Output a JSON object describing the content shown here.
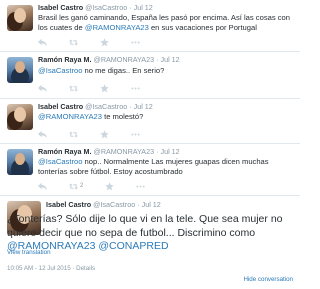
{
  "tweets": [
    {
      "name": "Isabel Castro",
      "handle": "@IsaCastroo",
      "time": "Jul 12",
      "text_before": "Brasil les ganó caminando, España les pasó por encima. Así las cosas con los cuates de ",
      "mention": "@RAMONRAYA23",
      "text_after": " en sus vacaciones por Portugal",
      "retweets": "",
      "favorites": ""
    },
    {
      "name": "Ramón Raya M.",
      "handle": "@RAMONRAYA23",
      "time": "Jul 12",
      "mention": "@IsaCastroo",
      "text_after": " no me digas.. En serio?",
      "retweets": "",
      "favorites": ""
    },
    {
      "name": "Isabel Castro",
      "handle": "@IsaCastroo",
      "time": "Jul 12",
      "mention": "@RAMONRAYA23",
      "text_after": " te molestó?",
      "retweets": "",
      "favorites": ""
    },
    {
      "name": "Ramón Raya M.",
      "handle": "@RAMONRAYA23",
      "time": "Jul 12",
      "mention": "@IsaCastroo",
      "text_after": " nop.. Normalmente Las mujeres guapas dicen muchas tonterías sobre fútbol. Estoy acostumbrado",
      "retweets": "2",
      "favorites": ""
    }
  ],
  "focused": {
    "name": "Isabel Castro",
    "handle": "@IsaCastroo",
    "time": "Jul 12",
    "text1": "¿Tonterías? Sólo dije lo que vi en la tele. Que sea mujer no quiere decir que no sepa de futbol... Discrimino como ",
    "mention1": "@RAMONRAYA23",
    "text2": " ",
    "mention2": "@CONAPRED",
    "view_translation": "View translation",
    "timestamp": "10:05 AM - 12 Jul 2015 · Details",
    "hide_conversation": "Hide conversation"
  },
  "icons": {
    "reply": "reply-icon",
    "retweet": "retweet-icon",
    "favorite": "star-icon",
    "more": "more-icon"
  },
  "colors": {
    "link": "#2b7bb9",
    "muted": "#8899a6",
    "action_icon": "#ccd6dd",
    "divider": "#e1e8ed"
  }
}
